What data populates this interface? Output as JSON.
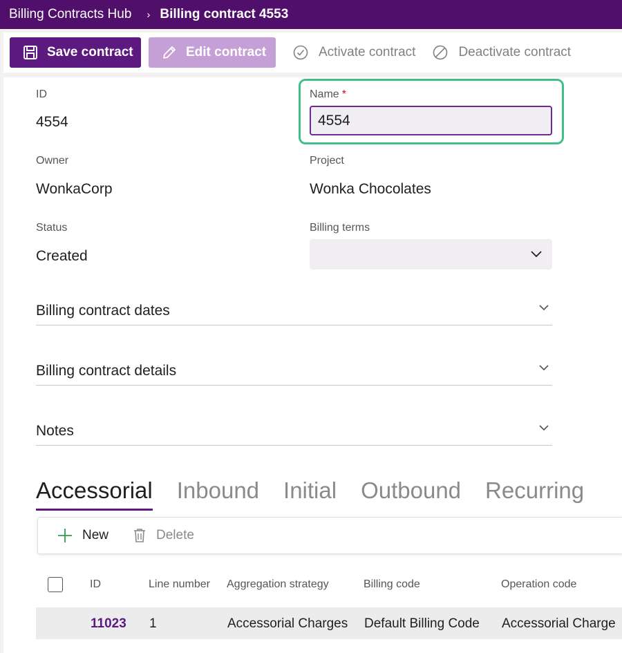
{
  "header": {
    "app_title": "Billing Contracts Hub",
    "separator": "›",
    "current_page": "Billing contract 4553"
  },
  "toolbar": {
    "save_label": "Save contract",
    "edit_label": "Edit contract",
    "activate_label": "Activate contract",
    "deactivate_label": "Deactivate contract"
  },
  "form": {
    "id_label": "ID",
    "id_value": "4554",
    "name_label": "Name",
    "name_required": "*",
    "name_value": "4554",
    "owner_label": "Owner",
    "owner_value": "WonkaCorp",
    "project_label": "Project",
    "project_value": "Wonka Chocolates",
    "status_label": "Status",
    "status_value": "Created",
    "billing_terms_label": "Billing terms",
    "billing_terms_value": ""
  },
  "sections": [
    {
      "title": "Billing contract dates"
    },
    {
      "title": "Billing contract details"
    },
    {
      "title": "Notes"
    }
  ],
  "tabs": [
    {
      "label": "Accessorial",
      "active": true
    },
    {
      "label": "Inbound",
      "active": false
    },
    {
      "label": "Initial",
      "active": false
    },
    {
      "label": "Outbound",
      "active": false
    },
    {
      "label": "Recurring",
      "active": false
    }
  ],
  "grid": {
    "new_label": "New",
    "delete_label": "Delete",
    "columns": [
      "ID",
      "Line number",
      "Aggregation strategy",
      "Billing code",
      "Operation code"
    ],
    "rows": [
      {
        "id": "11023",
        "line_number": "1",
        "aggregation_strategy": "Accessorial Charges",
        "billing_code": "Default Billing Code",
        "operation_code": "Accessorial Charge"
      }
    ]
  },
  "colors": {
    "brand": "#4f0f6b",
    "primary_button": "#5c1a80",
    "focus_ring": "#3fbf8a",
    "required": "#c50f1f",
    "link": "#5c1a80"
  }
}
